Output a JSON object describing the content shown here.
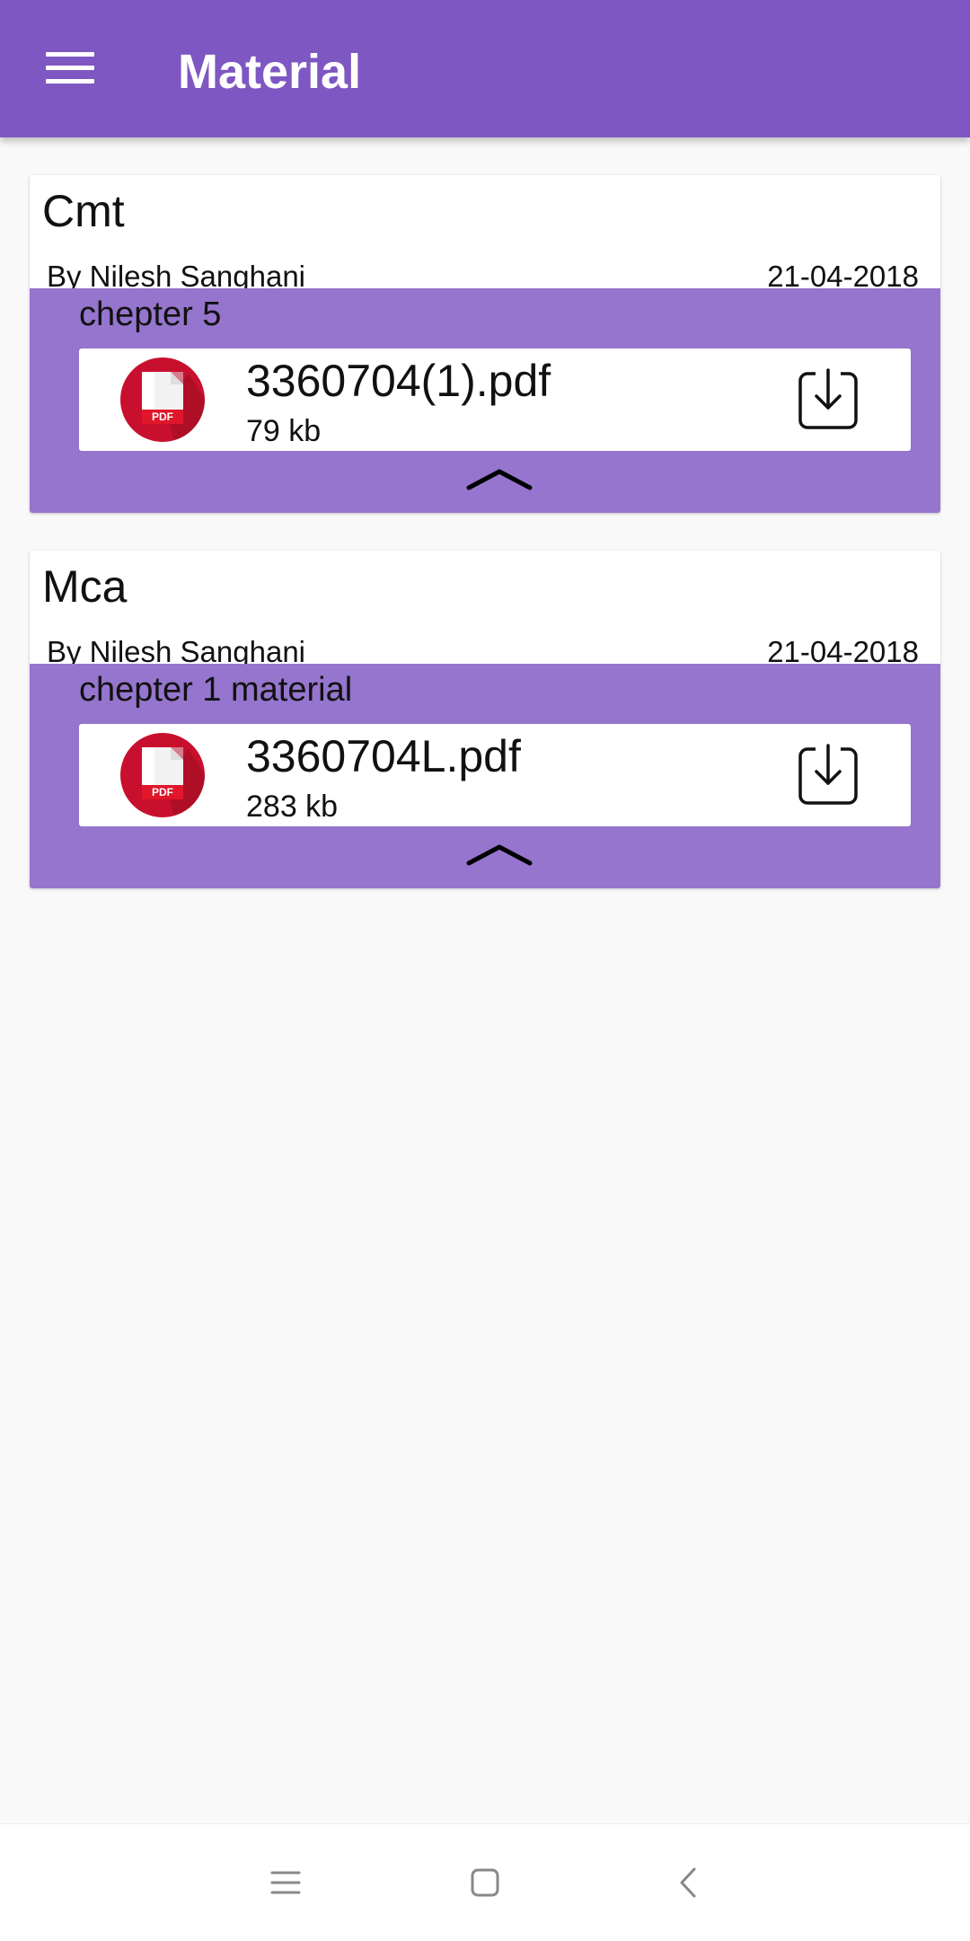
{
  "app_bar": {
    "title": "Material",
    "color": "#7e57c2",
    "menu_icon": "hamburger-menu-icon"
  },
  "materials": [
    {
      "subject": "Cmt",
      "author": "By Nilesh Sanghani",
      "date": "21-04-2018",
      "chapter": "chepter 5",
      "file": {
        "name": "3360704(1).pdf",
        "size": "79 kb",
        "type_icon": "pdf-icon",
        "type_label": "PDF"
      },
      "download_icon": "download-icon",
      "collapse_icon": "chevron-up-icon"
    },
    {
      "subject": "Mca",
      "author": "By Nilesh Sanghani",
      "date": "21-04-2018",
      "chapter": "chepter 1 material",
      "file": {
        "name": "3360704L.pdf",
        "size": "283 kb",
        "type_icon": "pdf-icon",
        "type_label": "PDF"
      },
      "download_icon": "download-icon",
      "collapse_icon": "chevron-up-icon"
    }
  ],
  "colors": {
    "card_body": "#9575cd",
    "pdf_red": "#c8102e",
    "background": "#f9f9f9"
  },
  "system_nav": {
    "items": [
      "recents-icon",
      "home-icon",
      "back-icon"
    ]
  }
}
